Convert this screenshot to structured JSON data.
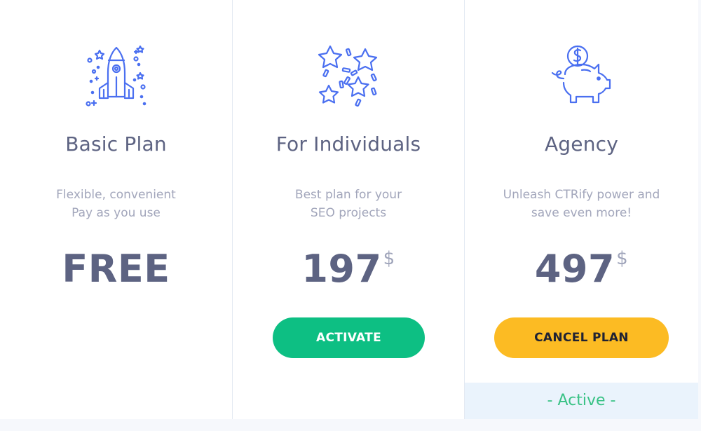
{
  "colors": {
    "accent_blue": "#4a6ff0",
    "activate_green": "#0dbf83",
    "cancel_yellow": "#fcbb23",
    "active_text_green": "#38c285"
  },
  "plans": [
    {
      "icon": "rocket-icon",
      "name": "Basic Plan",
      "description_line1": "Flexible, convenient",
      "description_line2": "Pay as you use",
      "price": "FREE"
    },
    {
      "icon": "stars-confetti-icon",
      "name": "For Individuals",
      "description_line1": "Best plan for your",
      "description_line2": "SEO projects",
      "price": "197",
      "currency": "$",
      "button_label": "ACTIVATE"
    },
    {
      "icon": "piggy-bank-icon",
      "name": "Agency",
      "description_line1": "Unleash CTRify power and",
      "description_line2": "save even more!",
      "price": "497",
      "currency": "$",
      "button_label": "CANCEL PLAN",
      "status_label": "- Active -"
    }
  ]
}
